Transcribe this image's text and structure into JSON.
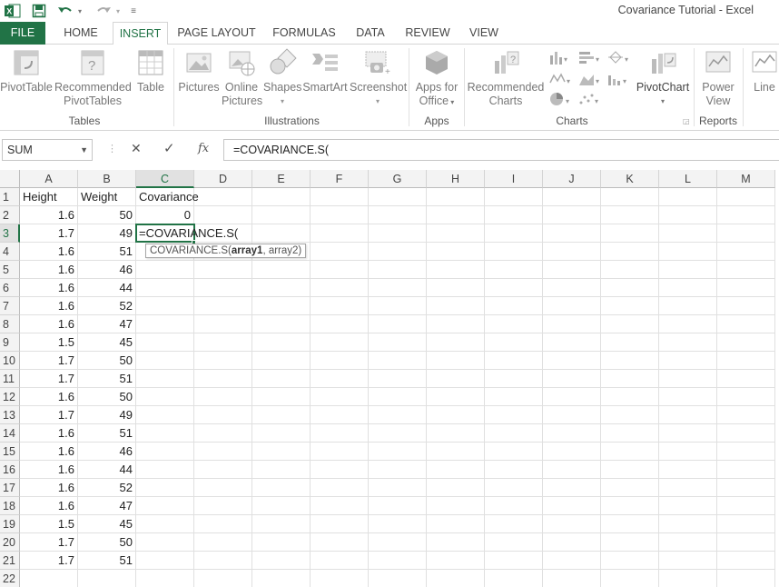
{
  "window": {
    "title": "Covariance Tutorial - Excel",
    "qat": {
      "excel_icon": "excel-logo-icon",
      "save_icon": "save-icon",
      "undo_icon": "undo-icon",
      "redo_icon": "redo-icon",
      "customize_icon": "customize-toolbar-icon"
    }
  },
  "tabs": [
    {
      "label": "FILE"
    },
    {
      "label": "HOME"
    },
    {
      "label": "INSERT"
    },
    {
      "label": "PAGE LAYOUT"
    },
    {
      "label": "FORMULAS"
    },
    {
      "label": "DATA"
    },
    {
      "label": "REVIEW"
    },
    {
      "label": "VIEW"
    }
  ],
  "active_tab": "INSERT",
  "ribbon": {
    "tables": {
      "pivottable": "PivotTable",
      "recommended_l1": "Recommended",
      "recommended_l2": "PivotTables",
      "table": "Table",
      "group": "Tables"
    },
    "illustrations": {
      "pictures": "Pictures",
      "online_l1": "Online",
      "online_l2": "Pictures",
      "shapes": "Shapes",
      "smartart": "SmartArt",
      "screenshot": "Screenshot",
      "group": "Illustrations"
    },
    "apps": {
      "apps_l1": "Apps for",
      "apps_l2": "Office",
      "group": "Apps"
    },
    "charts": {
      "rec_l1": "Recommended",
      "rec_l2": "Charts",
      "pivotchart": "PivotChart",
      "group": "Charts"
    },
    "reports": {
      "pv_l1": "Power",
      "pv_l2": "View",
      "group": "Reports"
    },
    "sparklines": {
      "line": "Line"
    }
  },
  "formula_bar": {
    "name_box": "SUM",
    "cancel_symbol": "✕",
    "enter_symbol": "✓",
    "fx": "fx",
    "formula": "=COVARIANCE.S("
  },
  "columns": [
    "A",
    "B",
    "C",
    "D",
    "E",
    "F",
    "G",
    "H",
    "I",
    "J",
    "K",
    "L",
    "M"
  ],
  "selected_column": "C",
  "selected_row": 3,
  "headers": {
    "a": "Height",
    "b": "Weight",
    "c": "Covariance"
  },
  "rows": [
    {
      "row": 2,
      "a": "1.6",
      "b": "50",
      "c": "0"
    },
    {
      "row": 3,
      "a": "1.7",
      "b": "49",
      "c": ""
    },
    {
      "row": 4,
      "a": "1.6",
      "b": "51",
      "c": ""
    },
    {
      "row": 5,
      "a": "1.6",
      "b": "46",
      "c": ""
    },
    {
      "row": 6,
      "a": "1.6",
      "b": "44",
      "c": ""
    },
    {
      "row": 7,
      "a": "1.6",
      "b": "52",
      "c": ""
    },
    {
      "row": 8,
      "a": "1.6",
      "b": "47",
      "c": ""
    },
    {
      "row": 9,
      "a": "1.5",
      "b": "45",
      "c": ""
    },
    {
      "row": 10,
      "a": "1.7",
      "b": "50",
      "c": ""
    },
    {
      "row": 11,
      "a": "1.7",
      "b": "51",
      "c": ""
    },
    {
      "row": 12,
      "a": "1.6",
      "b": "50",
      "c": ""
    },
    {
      "row": 13,
      "a": "1.7",
      "b": "49",
      "c": ""
    },
    {
      "row": 14,
      "a": "1.6",
      "b": "51",
      "c": ""
    },
    {
      "row": 15,
      "a": "1.6",
      "b": "46",
      "c": ""
    },
    {
      "row": 16,
      "a": "1.6",
      "b": "44",
      "c": ""
    },
    {
      "row": 17,
      "a": "1.6",
      "b": "52",
      "c": ""
    },
    {
      "row": 18,
      "a": "1.6",
      "b": "47",
      "c": ""
    },
    {
      "row": 19,
      "a": "1.5",
      "b": "45",
      "c": ""
    },
    {
      "row": 20,
      "a": "1.7",
      "b": "50",
      "c": ""
    },
    {
      "row": 21,
      "a": "1.7",
      "b": "51",
      "c": ""
    },
    {
      "row": 22,
      "a": "",
      "b": "",
      "c": ""
    }
  ],
  "active_cell": {
    "ref": "C3",
    "text": "=COVARIANCE.S("
  },
  "tooltip": {
    "func": "COVARIANCE.S(",
    "arg1": "array1",
    "rest": ", array2)"
  }
}
